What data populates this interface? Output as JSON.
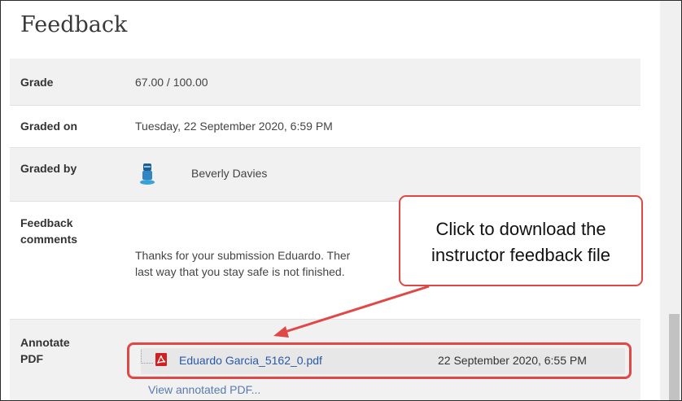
{
  "page": {
    "title": "Feedback"
  },
  "rows": {
    "grade": {
      "label": "Grade",
      "value": "67.00 / 100.00"
    },
    "graded_on": {
      "label": "Graded on",
      "value": "Tuesday, 22 September 2020, 6:59 PM"
    },
    "graded_by": {
      "label": "Graded by",
      "value": "Beverly Davies"
    },
    "comments": {
      "label_line1": "Feedback",
      "label_line2": "comments",
      "line1": "Thanks for your submission Eduardo.  Ther",
      "line2": "last way that you stay safe is not finished."
    },
    "annotate": {
      "label_line1": "Annotate",
      "label_line2": "PDF",
      "file_name": "Eduardo Garcia_5162_0.pdf",
      "file_date": "22 September 2020, 6:55 PM",
      "view_link": "View annotated PDF..."
    }
  },
  "callout": {
    "line1": "Click to download the",
    "line2": "instructor feedback file"
  },
  "colors": {
    "accent": "#e04848",
    "link": "#2a5aa3",
    "row_gray": "#f1f1f1"
  },
  "icons": [
    "user-avatar-icon",
    "pdf-file-icon",
    "callout-arrow"
  ]
}
